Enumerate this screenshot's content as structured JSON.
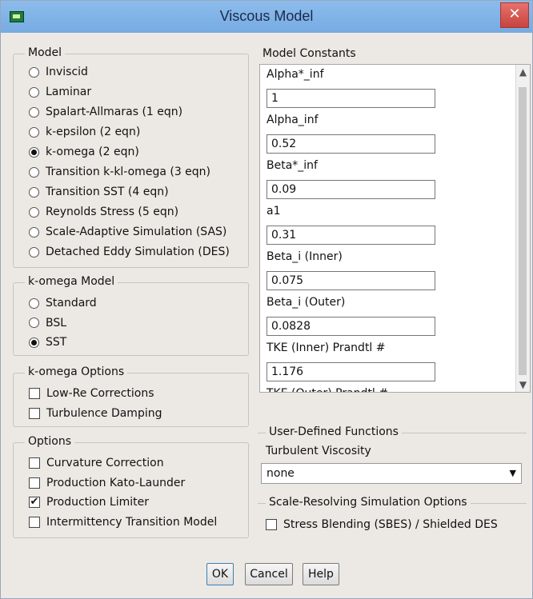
{
  "window": {
    "title": "Viscous Model"
  },
  "model": {
    "label": "Model",
    "options": [
      {
        "label": "Inviscid",
        "selected": false
      },
      {
        "label": "Laminar",
        "selected": false
      },
      {
        "label": "Spalart-Allmaras (1 eqn)",
        "selected": false
      },
      {
        "label": "k-epsilon (2 eqn)",
        "selected": false
      },
      {
        "label": "k-omega (2 eqn)",
        "selected": true
      },
      {
        "label": "Transition k-kl-omega (3 eqn)",
        "selected": false
      },
      {
        "label": "Transition SST (4 eqn)",
        "selected": false
      },
      {
        "label": "Reynolds Stress (5 eqn)",
        "selected": false
      },
      {
        "label": "Scale-Adaptive Simulation (SAS)",
        "selected": false
      },
      {
        "label": "Detached Eddy Simulation (DES)",
        "selected": false
      }
    ]
  },
  "komega_model": {
    "label": "k-omega Model",
    "options": [
      {
        "label": "Standard",
        "selected": false
      },
      {
        "label": "BSL",
        "selected": false
      },
      {
        "label": "SST",
        "selected": true
      }
    ]
  },
  "komega_options": {
    "label": "k-omega Options",
    "items": [
      {
        "label": "Low-Re Corrections",
        "checked": false
      },
      {
        "label": "Turbulence Damping",
        "checked": false
      }
    ]
  },
  "options": {
    "label": "Options",
    "items": [
      {
        "label": "Curvature Correction",
        "checked": false
      },
      {
        "label": "Production Kato-Launder",
        "checked": false
      },
      {
        "label": "Production Limiter",
        "checked": true
      },
      {
        "label": "Intermittency Transition Model",
        "checked": false
      }
    ]
  },
  "constants": {
    "label": "Model Constants",
    "items": [
      {
        "label": "Alpha*_inf",
        "value": "1"
      },
      {
        "label": "Alpha_inf",
        "value": "0.52"
      },
      {
        "label": "Beta*_inf",
        "value": "0.09"
      },
      {
        "label": "a1",
        "value": "0.31"
      },
      {
        "label": "Beta_i (Inner)",
        "value": "0.075"
      },
      {
        "label": "Beta_i (Outer)",
        "value": "0.0828"
      },
      {
        "label": "TKE (Inner) Prandtl #",
        "value": "1.176"
      },
      {
        "label": "TKE (Outer) Prandtl #",
        "value": ""
      }
    ]
  },
  "udf": {
    "label": "User-Defined Functions",
    "turbulent_viscosity_label": "Turbulent Viscosity",
    "turbulent_viscosity_value": "none"
  },
  "srs": {
    "label": "Scale-Resolving Simulation Options",
    "stress_blending_label": "Stress Blending (SBES) / Shielded DES",
    "stress_blending_checked": false
  },
  "buttons": {
    "ok": "OK",
    "cancel": "Cancel",
    "help": "Help"
  },
  "icons": {
    "app": "fluent-app-icon",
    "close": "close-icon"
  },
  "colors": {
    "titlebar": "#7fb3e8",
    "close": "#d9534f",
    "background": "#ece9e4"
  }
}
